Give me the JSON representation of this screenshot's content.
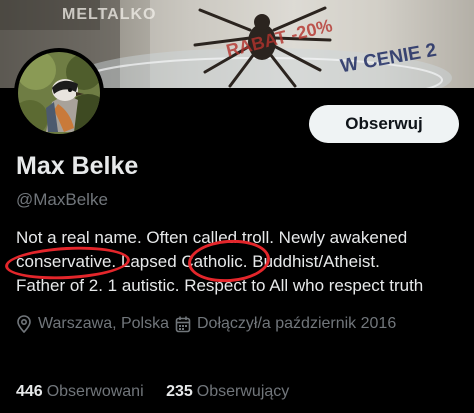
{
  "banner": {
    "text_top": "MELTALKO",
    "text_sale": "RABAT -20%",
    "text_promo": "W CENIE 2"
  },
  "profile": {
    "name": "Max Belke",
    "handle": "@MaxBelke",
    "follow_label": "Obserwuj",
    "bio_lines": [
      "Not a real name. Often called troll. Newly awakened",
      "conservative. Lapsed Catholic. Buddhist/Atheist.",
      "Father of 2. 1 autistic. Respect to All who respect truth"
    ],
    "location": "Warszawa, Polska",
    "joined": "Dołączył/a październik 2016",
    "following_count": "446",
    "following_label": "Obserwowani",
    "followers_count": "235",
    "followers_label": "Obserwujący"
  },
  "colors": {
    "background": "#000000",
    "primary_text": "#e7e9ea",
    "secondary_text": "#71767b",
    "button_bg": "#eff3f4",
    "annotation_red": "#e4262b"
  },
  "icons": {
    "location": "location-pin-icon",
    "joined": "calendar-icon"
  }
}
